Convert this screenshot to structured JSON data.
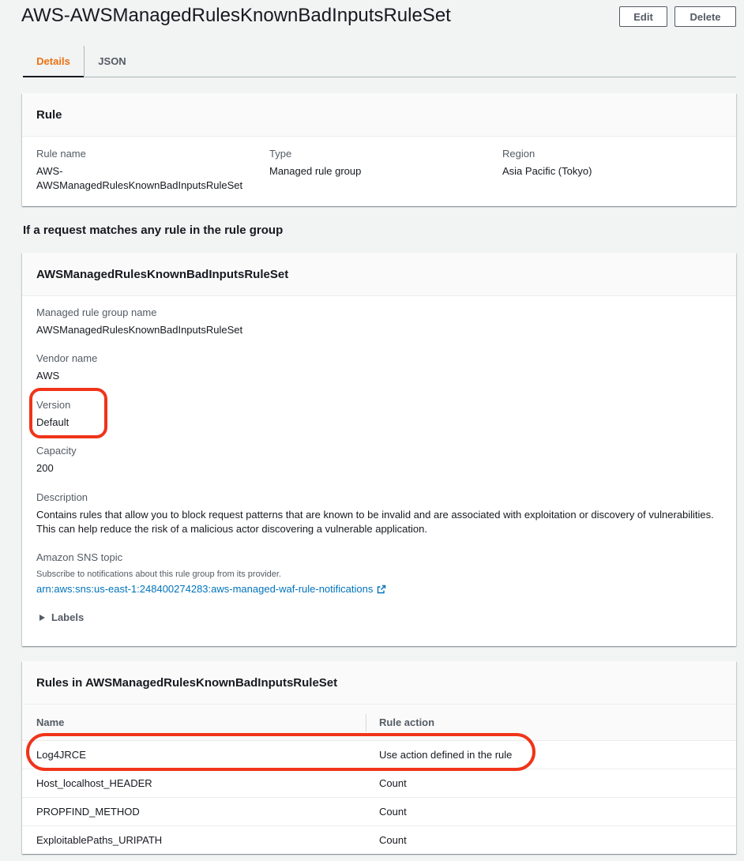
{
  "header": {
    "title": "AWS-AWSManagedRulesKnownBadInputsRuleSet",
    "edit_label": "Edit",
    "delete_label": "Delete"
  },
  "tabs": [
    {
      "label": "Details",
      "active": true
    },
    {
      "label": "JSON",
      "active": false
    }
  ],
  "rule_card": {
    "title": "Rule",
    "fields": [
      {
        "label": "Rule name",
        "value": "AWS-\nAWSManagedRulesKnownBadInputsRuleSet"
      },
      {
        "label": "Type",
        "value": "Managed rule group"
      },
      {
        "label": "Region",
        "value": "Asia Pacific (Tokyo)"
      }
    ]
  },
  "section_heading": "If a request matches any rule in the rule group",
  "group_card": {
    "title": "AWSManagedRulesKnownBadInputsRuleSet",
    "managed_rule_group_name_label": "Managed rule group name",
    "managed_rule_group_name": "AWSManagedRulesKnownBadInputsRuleSet",
    "vendor_name_label": "Vendor name",
    "vendor_name": "AWS",
    "version_label": "Version",
    "version": "Default",
    "capacity_label": "Capacity",
    "capacity": "200",
    "description_label": "Description",
    "description": "Contains rules that allow you to block request patterns that are known to be invalid and are associated with exploitation or discovery of vulnerabilities. This can help reduce the risk of a malicious actor discovering a vulnerable application.",
    "sns_label": "Amazon SNS topic",
    "sns_subtext": "Subscribe to notifications about this rule group from its provider.",
    "sns_arn": "arn:aws:sns:us-east-1:248400274283:aws-managed-waf-rule-notifications",
    "labels_toggle": "Labels"
  },
  "rules_card": {
    "title": "Rules in AWSManagedRulesKnownBadInputsRuleSet",
    "columns": [
      "Name",
      "Rule action"
    ],
    "rows": [
      {
        "name": "Log4JRCE",
        "action": "Use action defined in the rule"
      },
      {
        "name": "Host_localhost_HEADER",
        "action": "Count"
      },
      {
        "name": "PROPFIND_METHOD",
        "action": "Count"
      },
      {
        "name": "ExploitablePaths_URIPATH",
        "action": "Count"
      }
    ]
  },
  "colors": {
    "accent_orange": "#ec7211",
    "link_blue": "#0073bb",
    "highlight_red": "#f0341a"
  }
}
